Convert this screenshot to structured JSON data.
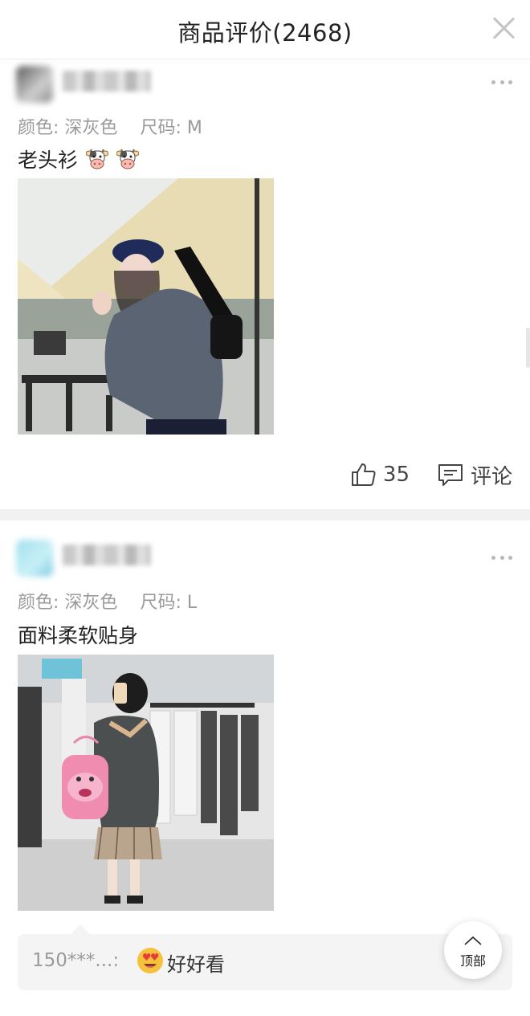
{
  "header": {
    "title": "商品评价(2468)"
  },
  "reviews": [
    {
      "spec_color_label": "颜色:",
      "spec_color_value": "深灰色",
      "spec_size_label": "尺码:",
      "spec_size_value": "M",
      "text": "老头衫",
      "emoji": [
        "cow-face-emoji",
        "cow-face-emoji"
      ],
      "likes": "35",
      "comment_label": "评论"
    },
    {
      "spec_color_label": "颜色:",
      "spec_color_value": "深灰色",
      "spec_size_label": "尺码:",
      "spec_size_value": "L",
      "text": "面料柔软贴身",
      "comment_preview": {
        "user": "150***...:",
        "emoji": "heart-eyes-emoji",
        "text": "好好看"
      }
    }
  ],
  "top_button": {
    "label": "顶部"
  },
  "colors": {
    "divider": "#f1f1f1",
    "muted_text": "#9a9a9a",
    "icon_gray": "#b8b8b8"
  }
}
